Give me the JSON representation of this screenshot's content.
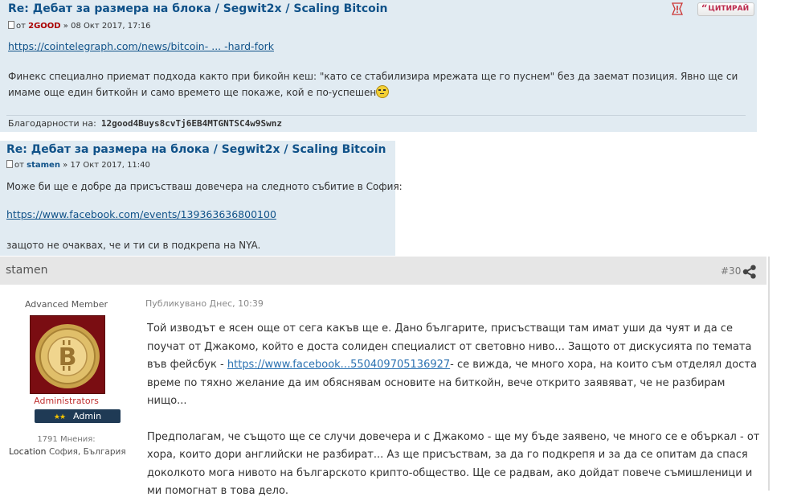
{
  "quote1": {
    "title": "Re: Дебат за размера на блока / Segwit2x / Scaling Bitcoin",
    "meta_prefix": "от",
    "author": "2GOOD",
    "date": "» 08 Окт 2017, 17:16",
    "link": "https://cointelegraph.com/news/bitcoin- ... -hard-fork",
    "text": "Финекс специално приемат подхода както при бикойн кеш: \"като се стабилизира мрежата ще го пуснем\" без да заемат позиция. Явно ще си имаме още един биткойн и само времето ще покаже, кой е по-успешен",
    "smiley_icon": "rolleyes-smiley",
    "thanks_label": "Благодарности на:",
    "thanks_address": "12good4Buys8cvTj6EB4MTGNTSC4w9Swnz",
    "report_icon": "warning-icon",
    "quote_button": "ЦИТИРАЙ"
  },
  "quote2": {
    "title": "Re: Дебат за размера на блока / Segwit2x / Scaling Bitcoin",
    "meta_prefix": "от",
    "author": "stamen",
    "date": "» 17 Окт 2017, 11:40",
    "text1": "Може би ще е добре да присъстваш довечера на следното събитие в София:",
    "link": "https://www.facebook.com/events/139363636800100",
    "text2": "защото не очаквах, че и ти си в подкрепа на NYA."
  },
  "post": {
    "username": "stamen",
    "number": "#30",
    "share_icon": "share-icon",
    "rank": "Advanced Member",
    "avatar_label": "Bitcoin coin avatar",
    "group": "Administrators",
    "badge_stars": "★★",
    "badge_label": "Admin",
    "posts_count": "1791 Мнения:",
    "location_label": "Location",
    "location_value": "София, България",
    "date": "Публикувано Днес, 10:39",
    "p1_before": "Той изводът е ясен още от сега какъв ще е. Дано българите, присъстващи там имат уши да чуят и да се поучат от Джакомо, който е доста солиден специалист от световно ниво... Защото от дискусията по темата във фейсбук - ",
    "p1_link": "https://www.facebook...550409705136927",
    "p1_after": "- се вижда, че много хора, на които съм отделял доста време по тяхно желание да им обяснявам основите на биткойн, вече открито заявяват, че не разбирам нищо...",
    "p2": "Предполагам, че същото ще се случи довечера и с Джакомо - ще му бъде заявено, че много се е объркал - от хора, които дори английски не разбират... Аз ще присъствам, за да го подкрепя и за да се опитам да спася доколкото мога нивото на българското крипто-общество. Ще се радвам, ако дойдат повече съмишленици и ми помогнат в това дело."
  },
  "colors": {
    "quote_bg": "#e1ebf2",
    "title_blue": "#105289",
    "author_red": "#aa0000",
    "header_gray": "#e6e6e6",
    "badge_navy": "#1f3a55",
    "group_red": "#c03030"
  }
}
